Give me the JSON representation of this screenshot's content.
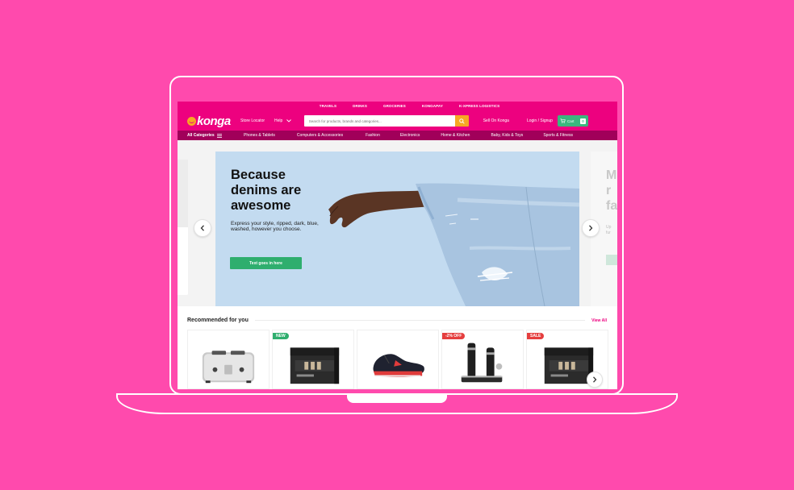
{
  "top_links": [
    "TRAVELS",
    "DRINKS",
    "GROCERIES",
    "KONGAPAY",
    "K-XPRESS LOGISTICS"
  ],
  "header": {
    "logo_text": "konga",
    "store_locator": "Store Locator",
    "help": "Help",
    "search_placeholder": "Search for products, brands and categories...",
    "sell": "Sell On Konga",
    "login": "Login / Signup",
    "cart_label": "Cart",
    "cart_count": "0"
  },
  "nav": {
    "all_categories": "All Categories",
    "categories": [
      "Phones & Tablets",
      "Computers & Accessories",
      "Fashion",
      "Electronics",
      "Home & Kitchen",
      "Baby, Kids & Toys",
      "Sports & Fitness"
    ]
  },
  "hero": {
    "title": "Because denims are awesome",
    "subtitle": "Express your style, ripped, dark, blue, washed, however you choose.",
    "cta": "Text goes in here",
    "next_slide_title": "M r fa",
    "next_slide_sub": "Up fur"
  },
  "recommended": {
    "title": "Recommended for you",
    "view_all": "View All",
    "products": [
      {
        "name": "toaster",
        "badge": ""
      },
      {
        "name": "boxed-product",
        "badge": "NEW"
      },
      {
        "name": "sneaker",
        "badge": ""
      },
      {
        "name": "wine-opener",
        "badge": "-2% OFF"
      },
      {
        "name": "boxed-product",
        "badge": "SALE"
      }
    ]
  },
  "colors": {
    "brand": "#ed017f",
    "brand_dark": "#a1005a",
    "accent": "#f7a823",
    "green": "#2fae6e",
    "background": "#ff4aad"
  }
}
